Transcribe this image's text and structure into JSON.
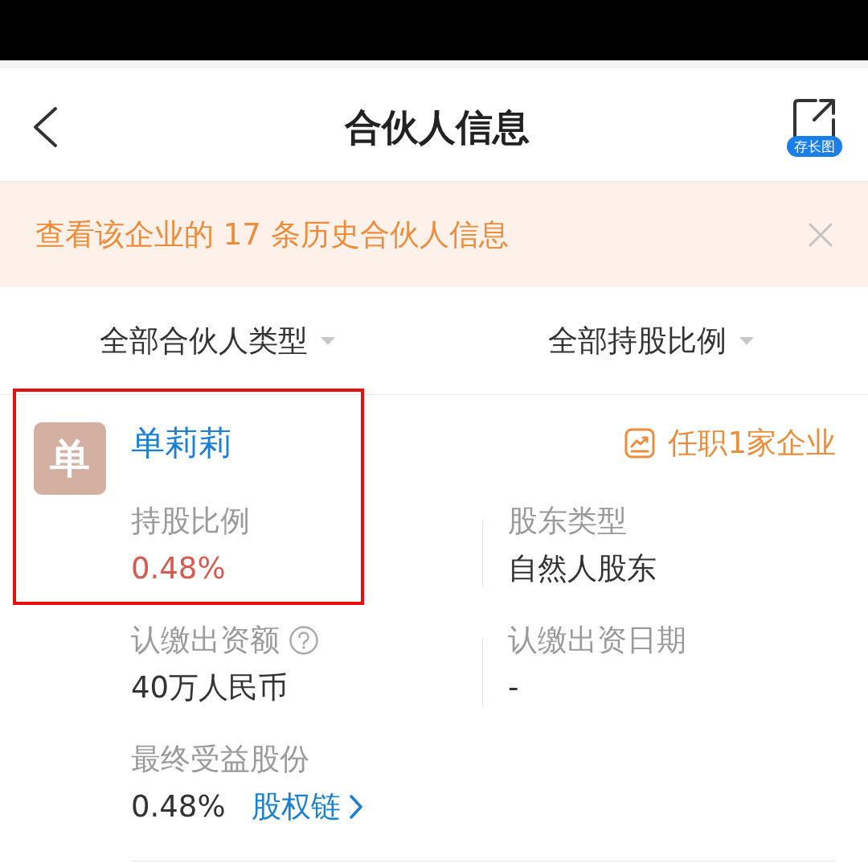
{
  "header": {
    "title": "合伙人信息",
    "save_label": "存长图"
  },
  "notice": {
    "text": "查看该企业的 17 条历史合伙人信息"
  },
  "filters": [
    {
      "label": "全部合伙人类型"
    },
    {
      "label": "全部持股比例"
    }
  ],
  "partners": [
    {
      "avatar": "单",
      "name": "单莉莉",
      "positions": "任职1家企业",
      "highlighted": true,
      "fields": [
        {
          "kind": "ratio",
          "label": "持股比例",
          "value": "0.48%"
        },
        {
          "kind": "text",
          "label": "股东类型",
          "value": "自然人股东"
        },
        {
          "kind": "help",
          "label": "认缴出资额",
          "value": "40万人民币"
        },
        {
          "kind": "text",
          "label": "认缴出资日期",
          "value": "-"
        },
        {
          "kind": "link",
          "label": "最终受益股份",
          "value": "0.48%",
          "link": "股权链"
        }
      ]
    }
  ]
}
